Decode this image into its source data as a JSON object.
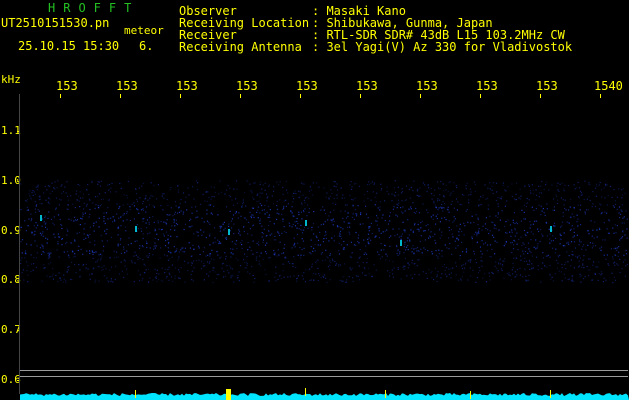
{
  "header": {
    "logo": "HROFFT",
    "filename": "UT2510151530.pn",
    "tag": "meteor",
    "datetime": "25.10.15 15:30",
    "count": "6."
  },
  "info": [
    {
      "label": "Observer",
      "value": ": Masaki Kano"
    },
    {
      "label": "Receiving Location",
      "value": ": Shibukawa, Gunma, Japan"
    },
    {
      "label": "Receiver",
      "value": ": RTL-SDR SDR# 43dB L15 103.2MHz CW"
    },
    {
      "label": "Receiving Antenna",
      "value": ": 3el Yagi(V) Az 330 for Vladivostok"
    }
  ],
  "axis": {
    "unit": "kHz",
    "time_ticks": [
      "153",
      "153",
      "153",
      "153",
      "153",
      "153",
      "153",
      "153",
      "153",
      "1540"
    ],
    "freq_ticks": [
      "1.1",
      "1.0",
      "0.9",
      "0.8",
      "0.7",
      "0.6"
    ]
  },
  "colors": {
    "text": "#ffff00",
    "logo": "#22c022",
    "noise": "#1e3cc8",
    "signal": "#00e5ff",
    "grid": "#9a9a9a"
  }
}
